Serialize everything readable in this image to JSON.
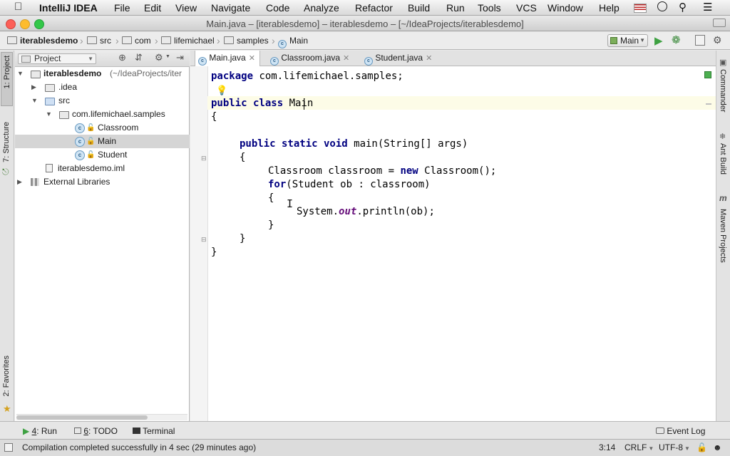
{
  "menubar": {
    "app": "IntelliJ IDEA",
    "items": [
      "File",
      "Edit",
      "View",
      "Navigate",
      "Code",
      "Analyze",
      "Refactor",
      "Build",
      "Run",
      "Tools",
      "VCS",
      "Window",
      "Help"
    ]
  },
  "window": {
    "title": "Main.java – [iterablesdemo] – iterablesdemo – [~/IdeaProjects/iterablesdemo]"
  },
  "breadcrumb": [
    "iterablesdemo",
    "src",
    "com",
    "lifemichael",
    "samples",
    "Main"
  ],
  "run_config": "Main",
  "left_stripe": {
    "project": "1: Project",
    "structure": "7: Structure",
    "favorites": "2: Favorites"
  },
  "right_stripe": {
    "commander": "Commander",
    "ant": "Ant Build",
    "maven": "Maven Projects"
  },
  "project_panel": {
    "title": "Project",
    "tree": {
      "root_name": "iterablesdemo",
      "root_path": "(~/IdeaProjects/iter",
      "idea": ".idea",
      "src": "src",
      "package": "com.lifemichael.samples",
      "classes": [
        "Classroom",
        "Main",
        "Student"
      ],
      "iml": "iterablesdemo.iml",
      "external": "External Libraries"
    }
  },
  "tabs": [
    "Main.java",
    "Classroom.java",
    "Student.java"
  ],
  "code": {
    "l1_kw": "package",
    "l1_rest": " com.lifemichael.samples;",
    "l3_kw": "public class",
    "l3_rest": " Main",
    "brace_open": "{",
    "l6_kw": "public static void",
    "l6_rest": " main(String[] args)",
    "l8_a": "Classroom classroom = ",
    "l8_kw": "new",
    "l8_b": " Classroom();",
    "l9_kw": "for",
    "l9_rest": "(Student ob : classroom)",
    "l11_a": "System.",
    "l11_it": "out",
    "l11_b": ".println(ob);",
    "brace_close": "}"
  },
  "bottom_tools": {
    "run_key": "4",
    "run_label": ": Run",
    "todo_key": "6",
    "todo_label": ": TODO",
    "terminal": "Terminal",
    "event_log": "Event Log"
  },
  "status": {
    "message": "Compilation completed successfully in 4 sec (29 minutes ago)",
    "position": "3:14",
    "line_sep": "CRLF",
    "encoding": "UTF-8"
  },
  "colors": {
    "keyword": "#000080",
    "static_field": "#660e7a",
    "caret_line": "#fdfce7",
    "selection": "#d5d5d5"
  }
}
